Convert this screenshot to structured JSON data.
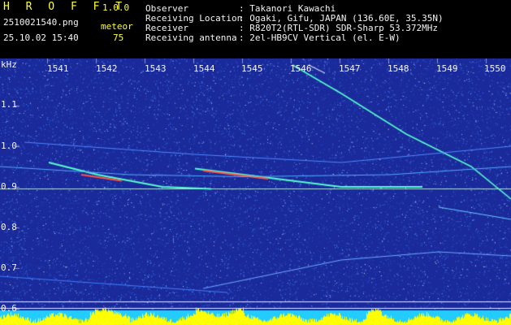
{
  "header": {
    "app_name": "H R O F F T",
    "version": "1.0.0",
    "filename": "2510021540.png",
    "datetime": "25.10.02 15:40",
    "meteor_label": "meteor",
    "meteor_count": "75",
    "fields": [
      {
        "label": "Observer",
        "value": ": Takanori Kawachi"
      },
      {
        "label": "Receiving Location",
        "value": ": Ogaki, Gifu, JAPAN (136.60E, 35.35N)"
      },
      {
        "label": "Receiver",
        "value": ": R820T2(RTL-SDR) SDR-Sharp 53.372MHz"
      },
      {
        "label": "Receiving antenna",
        "value": ": 2el-HB9CV Vertical (el. E-W)"
      }
    ]
  },
  "spectrogram": {
    "y_unit": "kHz",
    "y_ticks": [
      "1.1",
      "1.0",
      "0.9",
      "0.8",
      "0.7",
      "0.6"
    ],
    "x_ticks": [
      "1541",
      "1542",
      "1543",
      "1544",
      "1545",
      "1546",
      "1547",
      "1548",
      "1549",
      "1550"
    ],
    "colors": {
      "background": "#1a2a9a",
      "noise": "#3f7fff",
      "trace": "#55ffcc",
      "hot": "#ff5544",
      "level": "#ffff00",
      "bar_bg": "#22ccff"
    }
  }
}
